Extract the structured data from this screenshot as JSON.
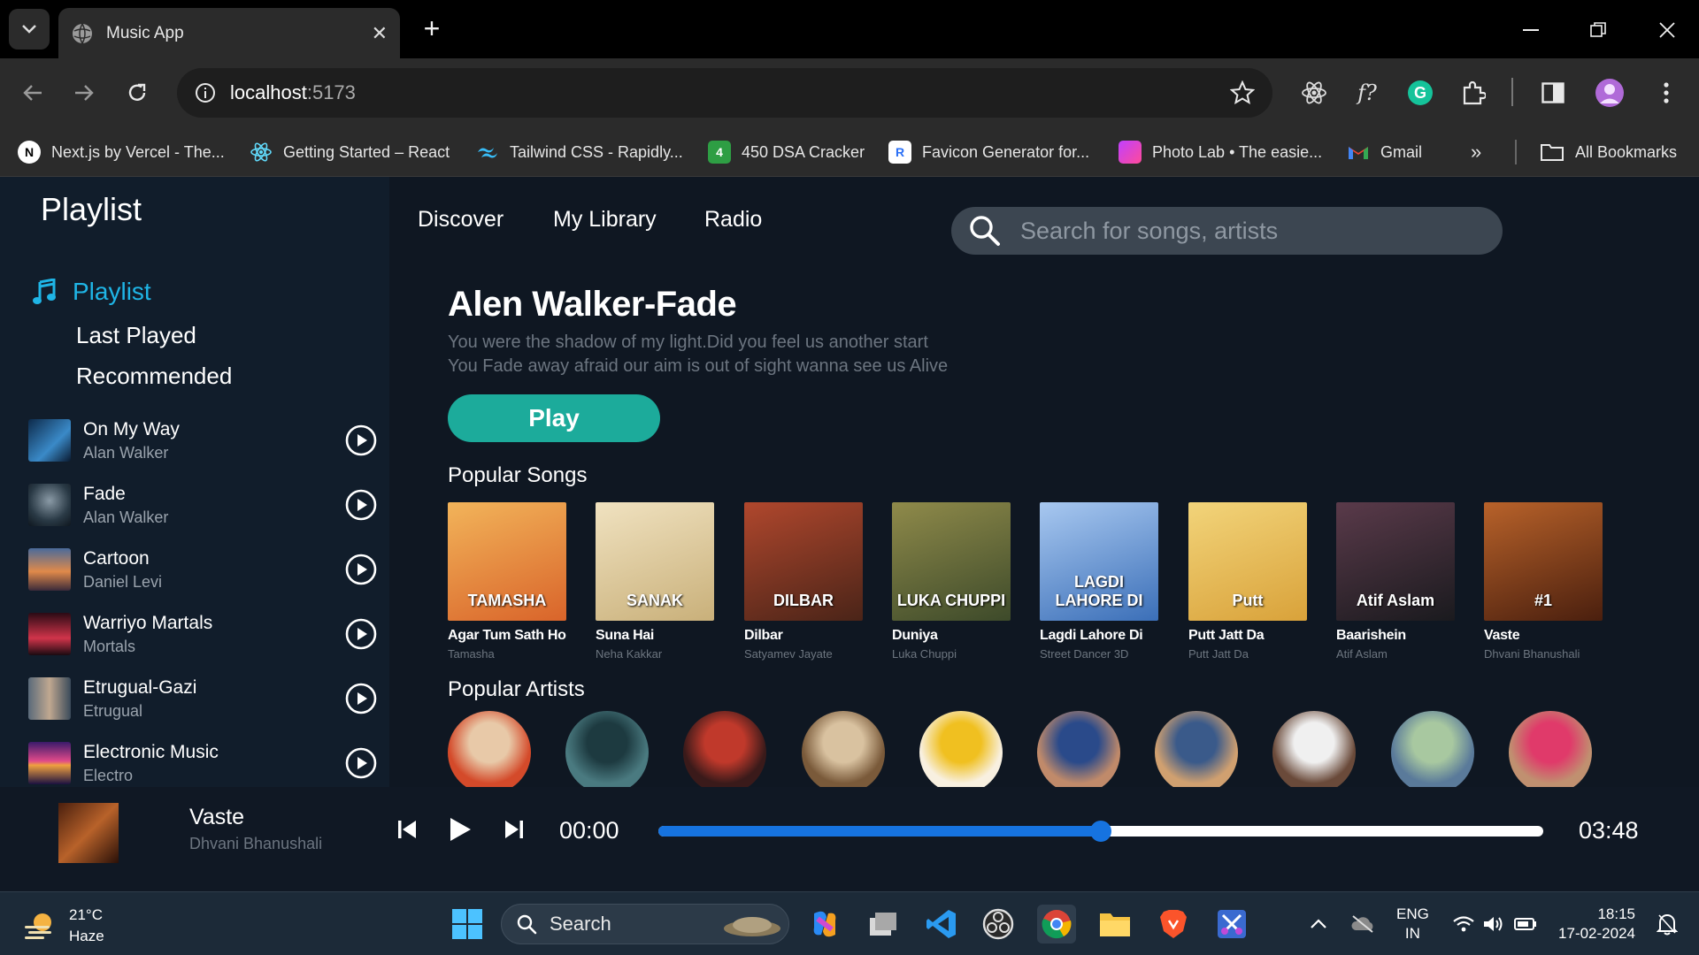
{
  "browser": {
    "tab_title": "Music App",
    "url_host": "localhost",
    "url_port": ":5173",
    "bookmarks": [
      {
        "label": "Next.js by Vercel - The...",
        "icon": "nextjs-icon",
        "color": "#000000"
      },
      {
        "label": "Getting Started – React",
        "icon": "react-icon",
        "color": "#61dafb"
      },
      {
        "label": "Tailwind CSS - Rapidly...",
        "icon": "tailwind-icon",
        "color": "#38bdf8"
      },
      {
        "label": "450 DSA Cracker",
        "icon": "dsa-icon",
        "color": "#2e9e44"
      },
      {
        "label": "Favicon Generator for...",
        "icon": "favicon-icon",
        "color": "#2a6ff5"
      },
      {
        "label": "Photo Lab • The easie...",
        "icon": "photolab-icon",
        "color": "#c040ff"
      },
      {
        "label": "Gmail",
        "icon": "gmail-icon",
        "color": "#ea4335"
      }
    ],
    "all_bookmarks": "All Bookmarks",
    "ext_font_label": "f?"
  },
  "sidebar": {
    "title": "Playlist",
    "nav_active": "Playlist",
    "nav_items": [
      "Last Played",
      "Recommended"
    ],
    "songs": [
      {
        "name": "On My Way",
        "artist": "Alan Walker"
      },
      {
        "name": "Fade",
        "artist": "Alan Walker"
      },
      {
        "name": "Cartoon",
        "artist": "Daniel Levi"
      },
      {
        "name": "Warriyo Martals",
        "artist": "Mortals"
      },
      {
        "name": "Etrugual-Gazi",
        "artist": "Etrugual"
      },
      {
        "name": "Electronic Music",
        "artist": "Electro"
      }
    ]
  },
  "topnav": {
    "links": [
      "Discover",
      "My Library",
      "Radio"
    ],
    "search_placeholder": "Search for songs, artists"
  },
  "hero": {
    "title": "Alen Walker-Fade",
    "line1": "You were the shadow of my light.Did you feel us another start",
    "line2": "You Fade away afraid our aim is out of sight wanna see us Alive",
    "play_label": "Play"
  },
  "popular_songs": {
    "title": "Popular Songs",
    "items": [
      {
        "title": "Agar Tum Sath Ho",
        "sub": "Tamasha",
        "cover_text": "TAMASHA",
        "c1": "#d9642a",
        "c2": "#f2b45a"
      },
      {
        "title": "Suna Hai",
        "sub": "Neha Kakkar",
        "cover_text": "SANAK",
        "c1": "#c9b07a",
        "c2": "#f0e2c0"
      },
      {
        "title": "Dilbar",
        "sub": "Satyamev Jayate",
        "cover_text": "DILBAR",
        "c1": "#4a2418",
        "c2": "#b0472d"
      },
      {
        "title": "Duniya",
        "sub": "Luka Chuppi",
        "cover_text": "LUKA CHUPPI",
        "c1": "#3d4a2a",
        "c2": "#8f8a4a"
      },
      {
        "title": "Lagdi Lahore Di",
        "sub": "Street Dancer 3D",
        "cover_text": "LAGDI LAHORE DI",
        "c1": "#3b6fb8",
        "c2": "#a8c8f0"
      },
      {
        "title": "Putt Jatt Da",
        "sub": "Putt Jatt Da",
        "cover_text": "Putt",
        "c1": "#d9a23a",
        "c2": "#f2d47a"
      },
      {
        "title": "Baarishein",
        "sub": "Atif Aslam",
        "cover_text": "Atif Aslam",
        "c1": "#1a1a1e",
        "c2": "#5a3a4a"
      },
      {
        "title": "Vaste",
        "sub": "Dhvani Bhanushali",
        "cover_text": "#1",
        "c1": "#4a1f0e",
        "c2": "#b8622a"
      }
    ]
  },
  "popular_artists": {
    "title": "Popular Artists",
    "items": [
      {
        "c1": "#e8c9a8",
        "c2": "#d44a2a"
      },
      {
        "c1": "#1d3a40",
        "c2": "#4a7a80"
      },
      {
        "c1": "#c0392b",
        "c2": "#3a1a1a"
      },
      {
        "c1": "#d9c2a0",
        "c2": "#7a5a3a"
      },
      {
        "c1": "#f0c020",
        "c2": "#f8f0e0"
      },
      {
        "c1": "#2a4a8a",
        "c2": "#c08a6a"
      },
      {
        "c1": "#3a5a8a",
        "c2": "#d0a070"
      },
      {
        "c1": "#f0f0f0",
        "c2": "#6a4a3a"
      },
      {
        "c1": "#a8c8a0",
        "c2": "#5a7a9a"
      },
      {
        "c1": "#e03a6a",
        "c2": "#c09070"
      }
    ]
  },
  "player": {
    "title": "Vaste",
    "artist": "Dhvani Bhanushali",
    "current_time": "00:00",
    "total_time": "03:48",
    "progress": 0.5
  },
  "taskbar": {
    "temp": "21°C",
    "condition": "Haze",
    "search_label": "Search",
    "lang1": "ENG",
    "lang2": "IN",
    "time": "18:15",
    "date": "17-02-2024"
  },
  "colors": {
    "accent": "#1fb5e6",
    "play_button": "#1cab9b",
    "progress": "#1673e0"
  }
}
